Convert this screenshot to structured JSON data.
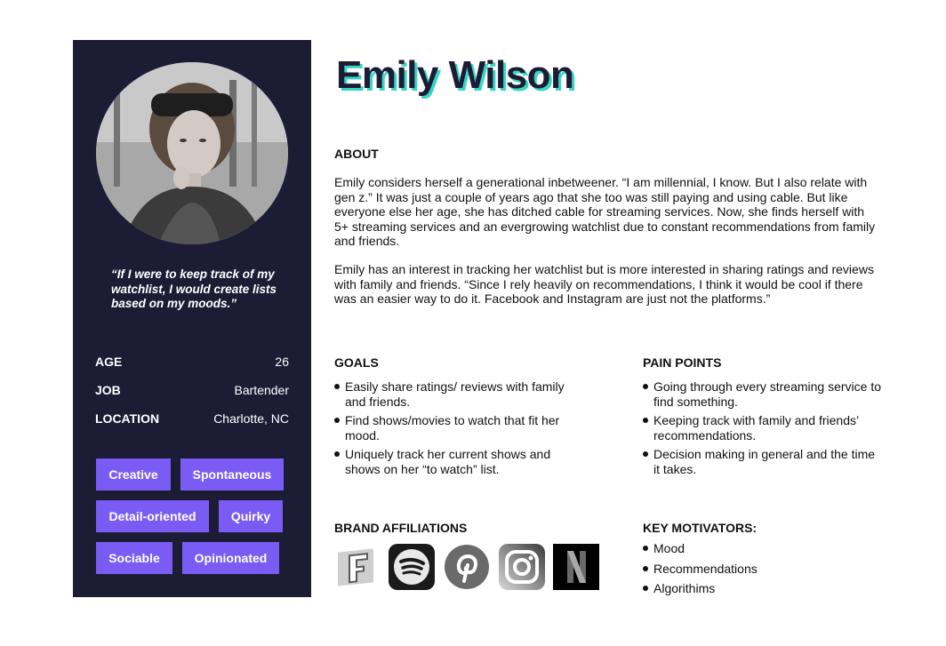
{
  "name": "Emily Wilson",
  "quote": "“If I were to keep track of my watchlist, I would create lists based on my moods.”",
  "info": [
    {
      "label": "AGE",
      "value": "26"
    },
    {
      "label": "JOB",
      "value": "Bartender"
    },
    {
      "label": "LOCATION",
      "value": "Charlotte, NC"
    }
  ],
  "traits": [
    "Creative",
    "Spontaneous",
    "Detail-oriented",
    "Quirky",
    "Sociable",
    "Opinionated"
  ],
  "about": {
    "heading": "ABOUT",
    "paragraphs": [
      "Emily considers herself a generational inbetweener. “I am millennial, I know. But I also relate with gen z.”   It was just a couple of years ago that she too was still paying and using cable. But like everyone else her age, she has ditched cable for streaming services. Now, she finds herself with 5+ streaming services and an evergrowing watchlist due to constant recommendations from family and friends.",
      "Emily has an interest in tracking her watchlist but is more interested in sharing ratings and reviews with family and friends. “Since I rely heavily on recommendations, I think it would be cool if there was an easier way to do it. Facebook and Instagram are just not the platforms.”"
    ]
  },
  "goals": {
    "heading": "GOALS",
    "items": [
      "Easily share ratings/ reviews with family and friends.",
      "Find shows/movies to watch that fit her mood.",
      "Uniquely track her current shows and shows on her “to watch” list."
    ]
  },
  "pain_points": {
    "heading": "PAIN POINTS",
    "items": [
      "Going through every streaming service to find something.",
      "Keeping track with family and friends’ recommendations.",
      "Decision making in general and the time it takes."
    ]
  },
  "brands": {
    "heading": "BRAND AFFILIATIONS",
    "icons": [
      "fandango-icon",
      "spotify-icon",
      "pinterest-icon",
      "instagram-icon",
      "netflix-icon"
    ]
  },
  "motivators": {
    "heading": "KEY MOTIVATORS:",
    "items": [
      "Mood",
      "Recommendations",
      "Algorithims"
    ]
  },
  "colors": {
    "sidebar": "#1d1c35",
    "tag": "#7a5cf5",
    "name_shadow": "#37d6c4"
  }
}
